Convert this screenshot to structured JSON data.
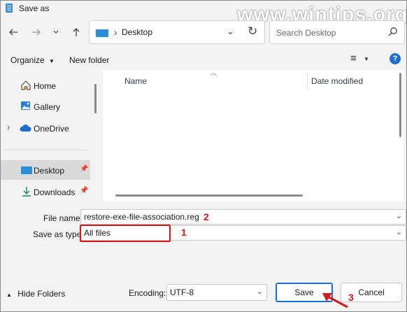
{
  "window": {
    "title": "Save as"
  },
  "watermark": "www.wintips.org",
  "nav": {
    "back_icon": "arrow-left-icon",
    "forward_icon": "arrow-right-icon",
    "dropdown_icon": "chevron-down-icon",
    "up_icon": "arrow-up-icon"
  },
  "address": {
    "path": "Desktop"
  },
  "search": {
    "placeholder": "Search Desktop"
  },
  "commands": {
    "organize": "Organize",
    "new_folder": "New folder"
  },
  "sidebar": {
    "items": [
      {
        "label": "Home",
        "icon": "home-icon"
      },
      {
        "label": "Gallery",
        "icon": "gallery-icon"
      },
      {
        "label": "OneDrive",
        "icon": "cloud-icon"
      },
      {
        "label": "Desktop",
        "icon": "desktop-folder-icon"
      },
      {
        "label": "Downloads",
        "icon": "download-icon"
      }
    ]
  },
  "filelist": {
    "columns": [
      "Name",
      "Date modified"
    ]
  },
  "form": {
    "file_name_label": "File name:",
    "file_name_value": "restore-exe-file-association.reg",
    "save_type_label": "Save as type:",
    "save_type_value": "All files"
  },
  "annotations": {
    "n1": "1",
    "n2": "2",
    "n3": "3"
  },
  "footer": {
    "hide_folders": "Hide Folders",
    "encoding_label": "Encoding:",
    "encoding_value": "UTF-8",
    "save": "Save",
    "cancel": "Cancel"
  },
  "colors": {
    "accent": "#1a6fd0",
    "annotation": "#d81818",
    "selected": "#dadada"
  }
}
